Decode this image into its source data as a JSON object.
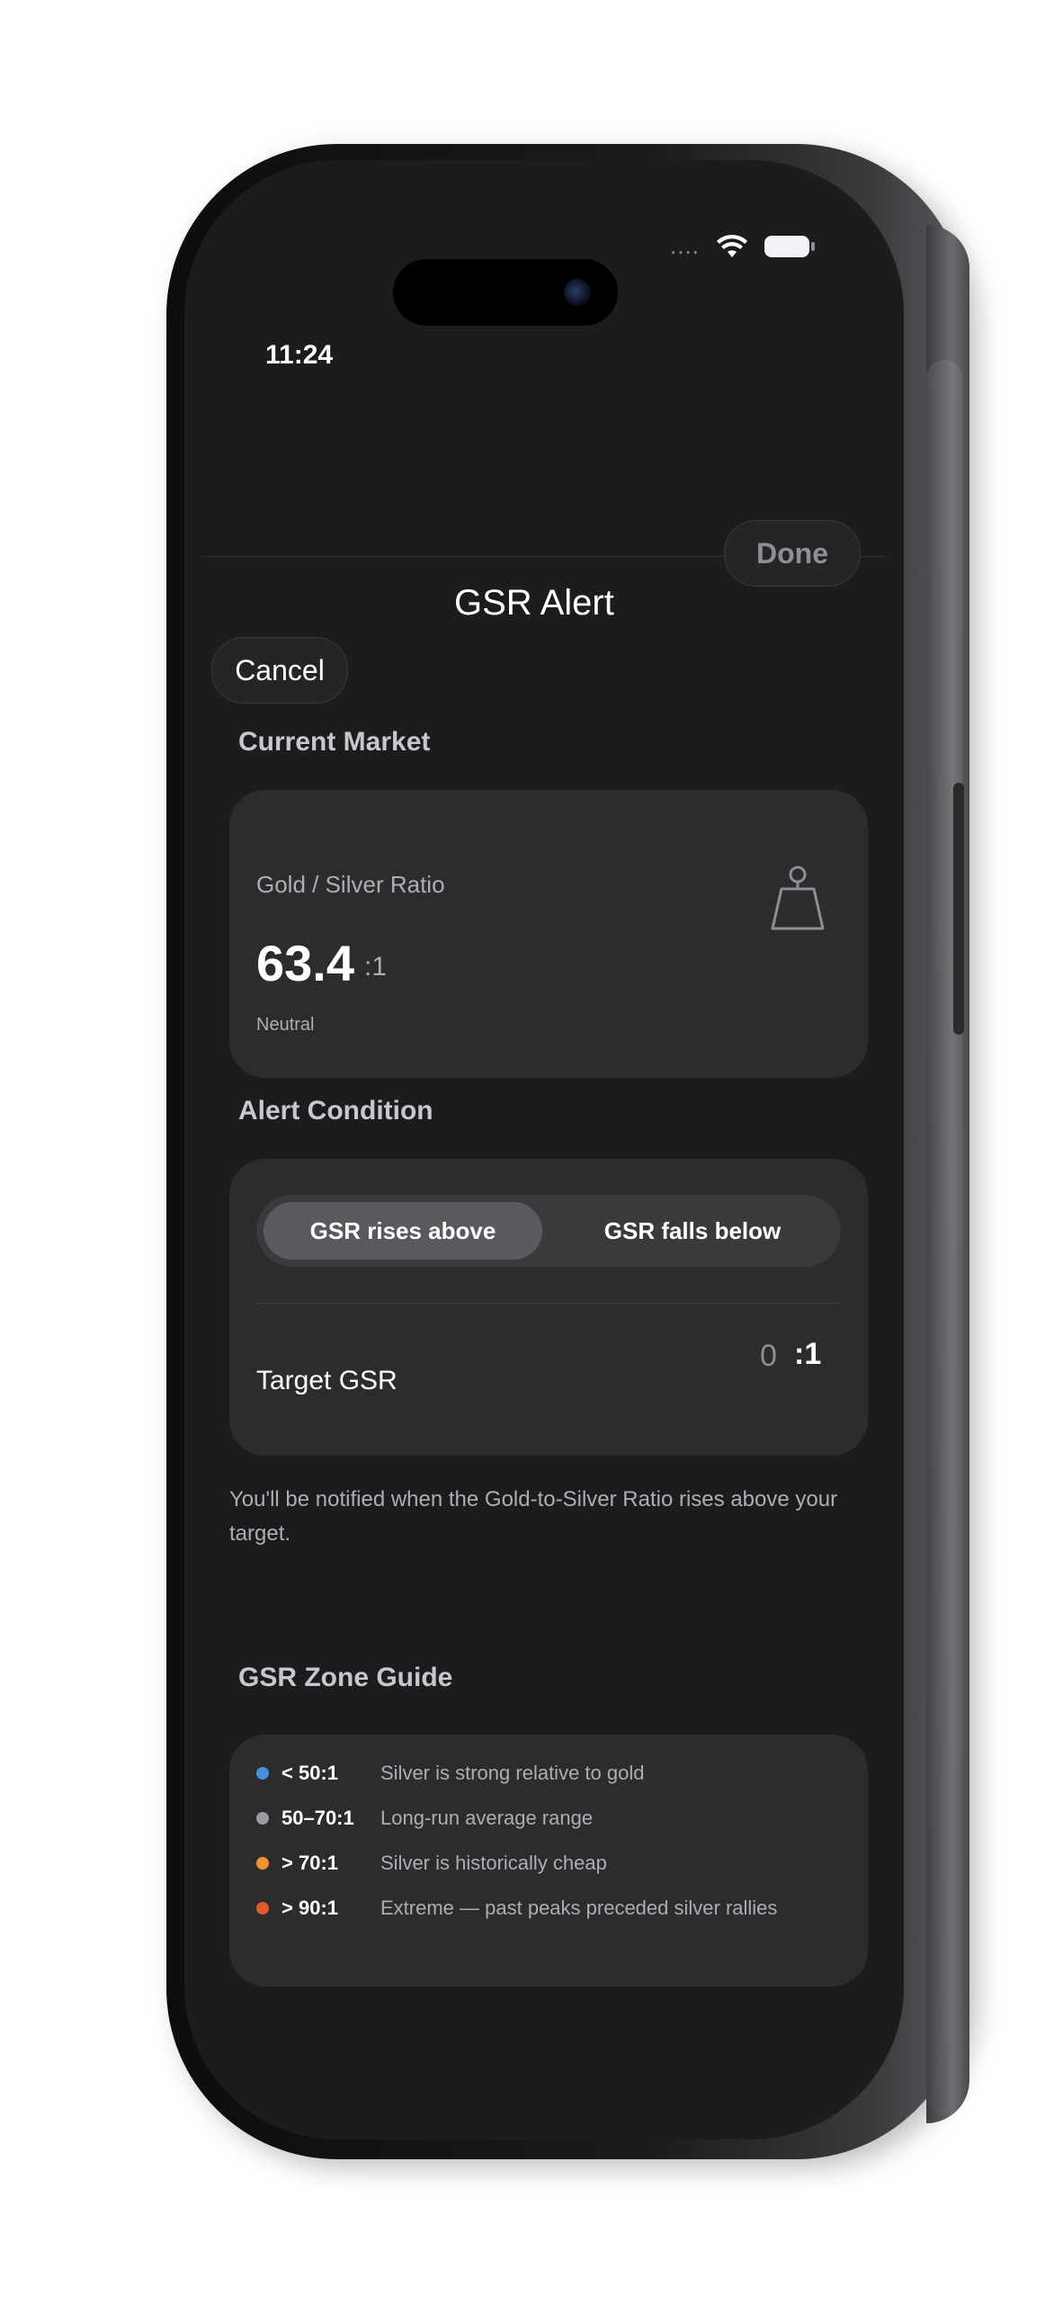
{
  "status_bar": {
    "time": "11:24",
    "signal": "....",
    "wifi_icon": "wifi-icon",
    "battery_icon": "battery-icon"
  },
  "nav": {
    "cancel_label": "Cancel",
    "title": "GSR Alert",
    "done_label": "Done"
  },
  "current_market": {
    "section_title": "Current Market",
    "label": "Gold / Silver Ratio",
    "value": "63.4",
    "suffix": ":1",
    "sentiment": "Neutral",
    "icon": "scale-icon"
  },
  "alert_condition": {
    "section_title": "Alert Condition",
    "options": [
      "GSR rises above",
      "GSR falls below"
    ],
    "selected": "GSR rises above",
    "target_label": "Target GSR",
    "target_value": "0",
    "target_suffix": ":1"
  },
  "footnote": "You'll be notified when the Gold-to-Silver Ratio rises above your target.",
  "zone_guide": {
    "section_title": "GSR Zone Guide",
    "zones": [
      {
        "range": "< 50:1",
        "desc": "Silver is strong relative to gold",
        "color": "#4a90d9"
      },
      {
        "range": "50–70:1",
        "desc": "Long-run average range",
        "color": "#9a9aa0"
      },
      {
        "range": "> 70:1",
        "desc": "Silver is historically cheap",
        "color": "#f0932b"
      },
      {
        "range": "> 90:1",
        "desc": "Extreme — past peaks preceded silver rallies",
        "color": "#e05a2b"
      }
    ]
  }
}
